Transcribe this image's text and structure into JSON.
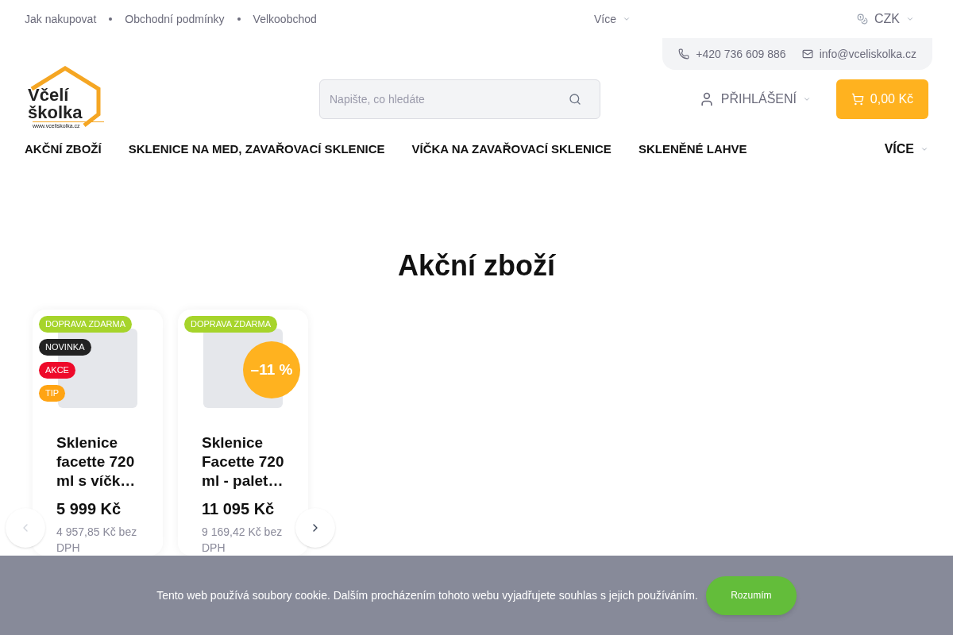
{
  "top_links": [
    "Jak nakupovat",
    "Obchodní podmínky",
    "Velkoobchod"
  ],
  "more_menu": "Více",
  "currency": "CZK",
  "contact": {
    "phone": "+420 736 609 886",
    "email": "info@vceliskolka.cz"
  },
  "logo": {
    "line1": "Včelí",
    "line2": "školka",
    "url": "www.vceliskolka.cz"
  },
  "search": {
    "placeholder": "Napište, co hledáte"
  },
  "login": "PŘIHLÁŠENÍ",
  "cart": "0,00 Kč",
  "nav": [
    "AKČNÍ ZBOŽÍ",
    "SKLENICE NA MED, ZAVAŘOVACÍ SKLENICE",
    "VÍČKA NA ZAVAŘOVACÍ SKLENICE",
    "SKLENĚNÉ LAHVE"
  ],
  "nav_more": "VÍCE",
  "heading": "Akční zboží",
  "products": [
    {
      "flags": [
        {
          "label": "DOPRAVA ZDARMA",
          "color": "#a6d42b"
        },
        {
          "label": "NOVINKA",
          "color": "#222222"
        },
        {
          "label": "AKCE",
          "color": "#ee0a2a"
        },
        {
          "label": "TIP",
          "color": "#ffa413"
        }
      ],
      "name": "Sklenice facette 720 ml s víčk…",
      "price": "5 999 Kč",
      "price_net": "4 957,85 Kč bez DPH"
    },
    {
      "flags": [
        {
          "label": "DOPRAVA ZDARMA",
          "color": "#a6d42b"
        }
      ],
      "discount": "–11 %",
      "name": "Sklenice Facette 720 ml - palet…",
      "price": "11 095 Kč",
      "price_net": "9 169,42 Kč bez DPH"
    }
  ],
  "cookie": {
    "text": "Tento web používá soubory cookie. Dalším procházením tohoto webu vyjadřujete souhlas s jejich používáním.",
    "button": "Rozumím"
  }
}
